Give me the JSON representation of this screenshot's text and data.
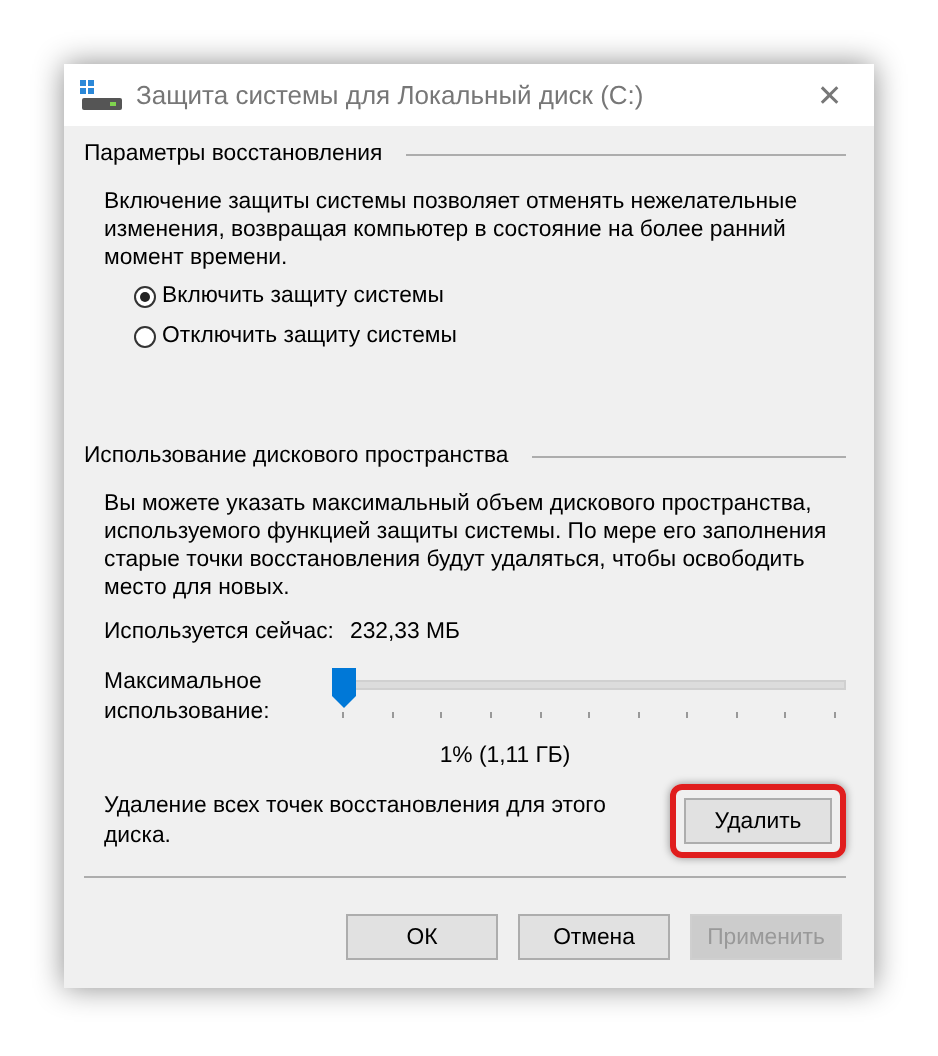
{
  "window": {
    "title": "Защита системы для Локальный диск (C:)",
    "close": "✕"
  },
  "restore_settings": {
    "heading": "Параметры восстановления",
    "description": "Включение защиты системы позволяет отменять нежелательные изменения, возвращая компьютер в состояние на более ранний момент времени.",
    "options": [
      {
        "label": "Включить защиту системы",
        "selected": true
      },
      {
        "label": "Отключить защиту системы",
        "selected": false
      }
    ]
  },
  "disk_usage": {
    "heading": "Использование дискового пространства",
    "description": "Вы можете указать максимальный объем дискового пространства, используемого функцией защиты системы. По мере его заполнения старые точки восстановления будут удаляться, чтобы освободить место для новых.",
    "current_label": "Используется сейчас:",
    "current_value": "232,33 МБ",
    "max_label": "Максимальное использование:",
    "slider": {
      "level": 0
    },
    "max_value": "1% (1,11 ГБ)",
    "delete_text": "Удаление всех точек восстановления для этого диска.",
    "delete_button": {
      "label": "Удалить",
      "highlighted": true
    }
  },
  "buttons": [
    {
      "label": "ОК",
      "disabled": false
    },
    {
      "label": "Отмена",
      "disabled": false
    },
    {
      "label": "Применить",
      "disabled": true
    }
  ]
}
